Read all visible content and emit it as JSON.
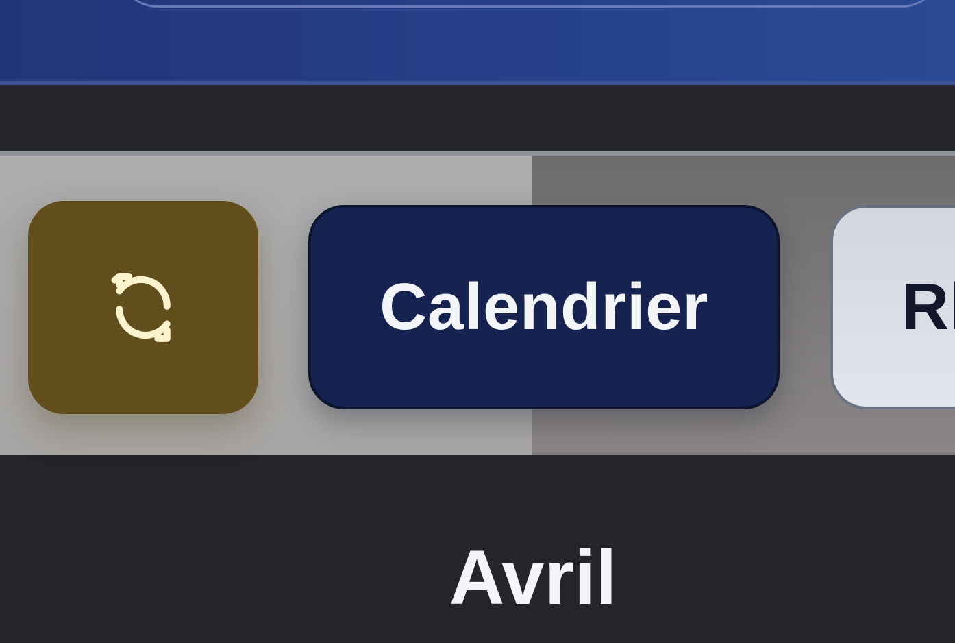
{
  "toolbar": {
    "refresh_icon": "refresh-icon",
    "refresh_color": "#624e1c",
    "calendar_label": "Calendrier",
    "calendar_color": "#16224f",
    "third_label": "Rl"
  },
  "main": {
    "month_title": "Avril"
  },
  "colors": {
    "header_blue": "#26408a",
    "page_background": "#232528",
    "icon_cream": "#fdf3cf"
  }
}
